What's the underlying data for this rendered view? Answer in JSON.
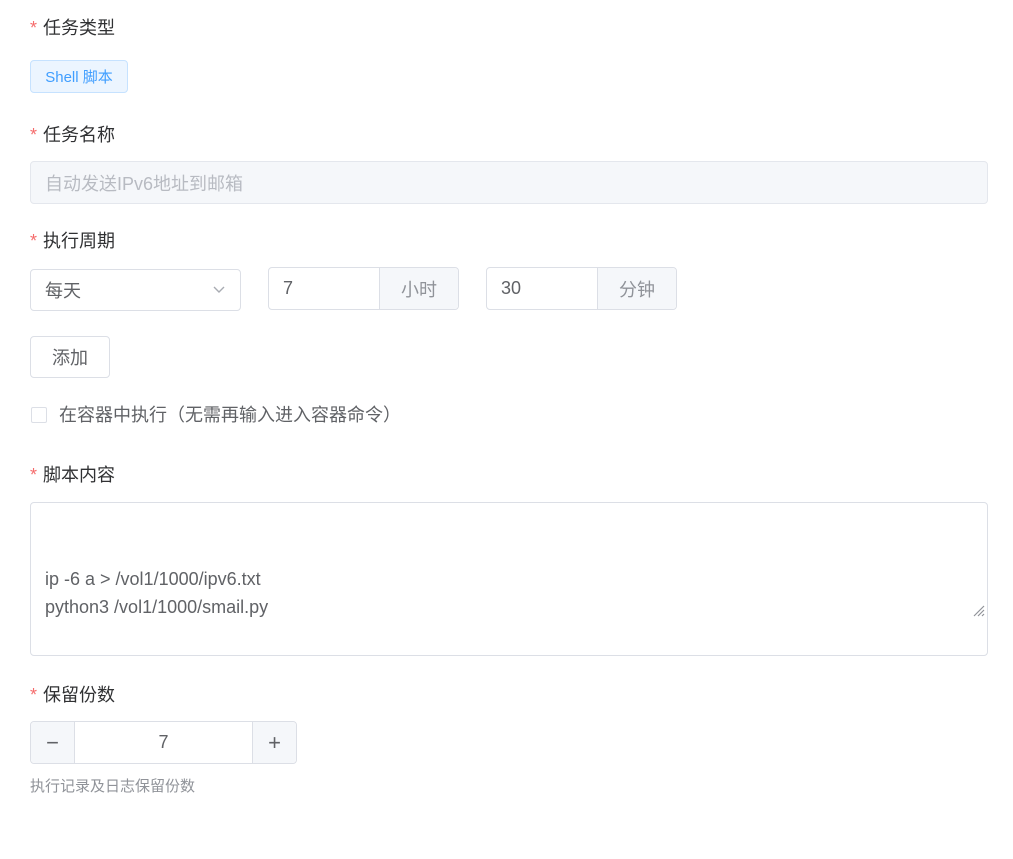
{
  "task_type": {
    "label": "任务类型",
    "tag": "Shell 脚本"
  },
  "task_name": {
    "label": "任务名称",
    "value": "自动发送IPv6地址到邮箱"
  },
  "schedule": {
    "label": "执行周期",
    "period": "每天",
    "hour_value": "7",
    "hour_unit": "小时",
    "minute_value": "30",
    "minute_unit": "分钟",
    "add_button": "添加"
  },
  "container": {
    "label": "在容器中执行（无需再输入进入容器命令）",
    "checked": false
  },
  "script": {
    "label": "脚本内容",
    "content": "ip -6 a > /vol1/1000/ipv6.txt\npython3 /vol1/1000/smail.py"
  },
  "retention": {
    "label": "保留份数",
    "minus": "−",
    "value": "7",
    "plus": "+",
    "hint": "执行记录及日志保留份数"
  },
  "required_mark": "*"
}
